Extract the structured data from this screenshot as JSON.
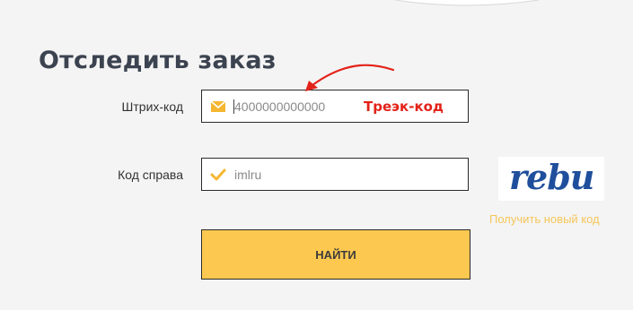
{
  "page": {
    "title": "Отследить заказ"
  },
  "form": {
    "barcode": {
      "label": "Штрих-код",
      "value": "4000000000000",
      "icon": "envelope-icon",
      "annotation": "Треэк-код"
    },
    "captcha": {
      "label": "Код справа",
      "value": "imlru",
      "icon": "check-icon",
      "image_text": "rebu",
      "refresh_label": "Получить новый код"
    },
    "submit_label": "НАЙТИ"
  },
  "colors": {
    "accent": "#fdc84f",
    "icon": "#f5b731",
    "annotation": "#e32219",
    "title": "#3c4350",
    "captcha": "#1f4f9c"
  }
}
